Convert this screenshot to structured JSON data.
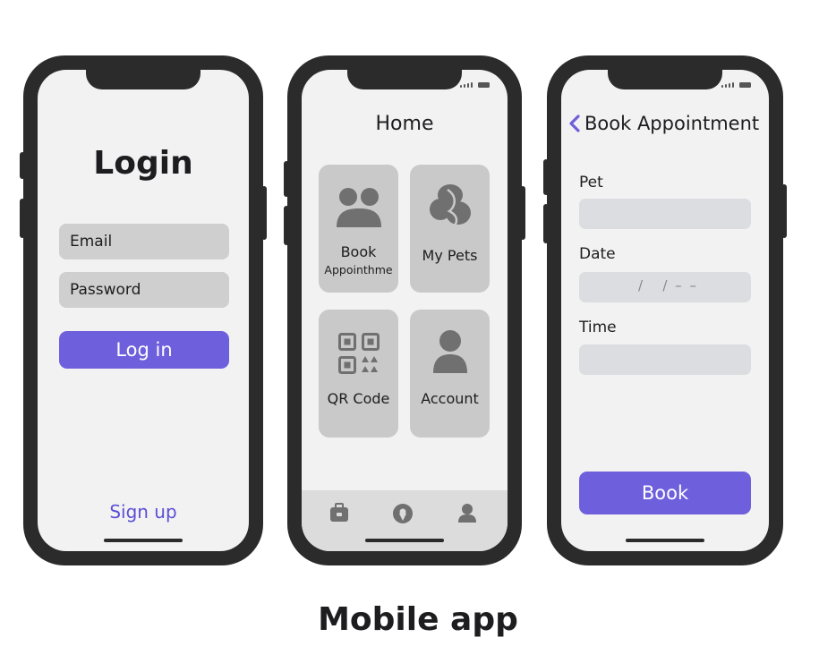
{
  "caption": "Mobile app",
  "colors": {
    "accent": "#6e5fdc",
    "phone_frame": "#2b2b2b",
    "screen_bg": "#f2f2f3",
    "field_bg": "#cfcfcf",
    "tile_bg": "#c9c9c9"
  },
  "login": {
    "title": "Login",
    "email_placeholder": "Email",
    "password_placeholder": "Password",
    "login_button": "Log in",
    "signup_link": "Sign up"
  },
  "home": {
    "title": "Home",
    "tiles": [
      {
        "label": "Book",
        "sublabel": "Appointhme",
        "icon": "people-icon"
      },
      {
        "label": "My Pets",
        "icon": "pet-icon"
      },
      {
        "label": "QR Code",
        "icon": "qr-code-icon"
      },
      {
        "label": "Account",
        "icon": "account-icon"
      }
    ],
    "tabbar": [
      "briefcase-icon",
      "location-pin-icon",
      "profile-icon"
    ]
  },
  "booking": {
    "title": "Book Appointment",
    "back_icon": "chevron-left-icon",
    "pet_label": "Pet",
    "date_label": "Date",
    "date_placeholder": "/   / – –",
    "time_label": "Time",
    "book_button": "Book"
  }
}
